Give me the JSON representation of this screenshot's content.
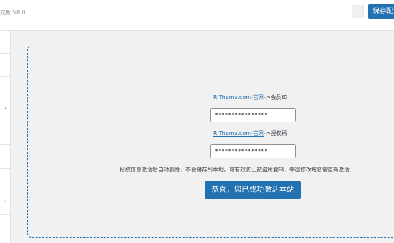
{
  "header": {
    "version_text": "式版 V8.0",
    "list_icon": "list-icon",
    "save_label": "保存配置"
  },
  "sidebar": {
    "chevron": "›"
  },
  "auth": {
    "member_link": "RiTheme.com-官网",
    "member_suffix": "->会员ID",
    "member_value": "****************",
    "code_link": "RiTheme.com-官网",
    "code_suffix": "->授权码",
    "code_value": "****************",
    "notice": "授权信息激活后自动删除，不会储存到本地，可有效防止被盗用复制，中途修改域名需重新激活",
    "activate_label": "恭喜，您已成功激活本站"
  }
}
